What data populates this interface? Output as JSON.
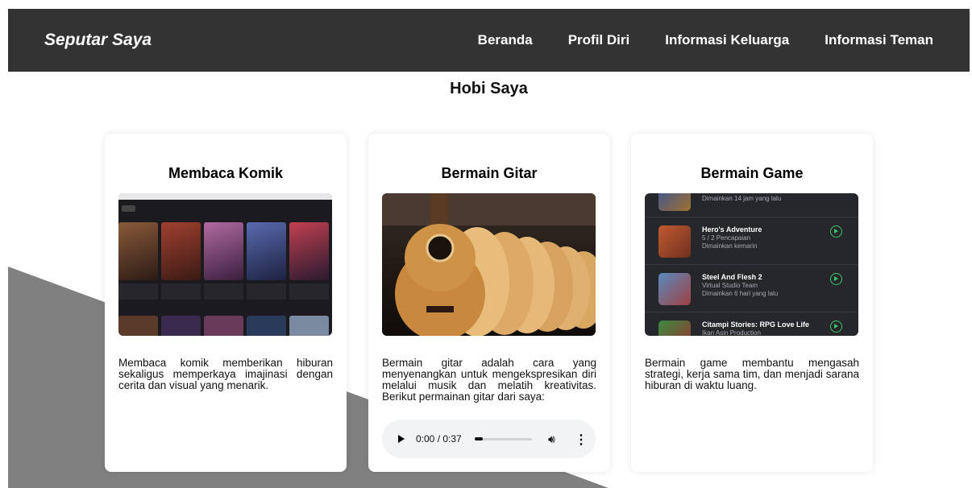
{
  "navbar": {
    "brand": "Seputar Saya",
    "links": [
      "Beranda",
      "Profil Diri",
      "Informasi Keluarga",
      "Informasi Teman"
    ]
  },
  "section": {
    "title": "Hobi Saya"
  },
  "cards": [
    {
      "title": "Membaca Komik",
      "description": "Membaca komik memberikan hiburan sekaligus memperkaya imajinasi dengan cerita dan visual yang menarik."
    },
    {
      "title": "Bermain Gitar",
      "description": "Bermain gitar adalah cara yang menyenangkan untuk mengekspresikan diri melalui musik dan melatih kreativitas. Berikut permainan gitar dari saya:",
      "audio": {
        "time": "0:00 / 0:37",
        "progress": 0.0
      }
    },
    {
      "title": "Bermain Game",
      "description": "Bermain game membantu mengasah strategi, kerja sama tim, dan menjadi sarana hiburan di waktu luang.",
      "games": [
        {
          "name": "",
          "sub": "Dimainkan 14 jam yang lalu",
          "sub2": ""
        },
        {
          "name": "Hero's Adventure",
          "sub": "5 / 2 Pencapaian",
          "sub2": "Dimainkan kemarin"
        },
        {
          "name": "Steel And Flesh 2",
          "sub": "Virtual Studio Team",
          "sub2": "Dimainkan 6 hari yang lalu"
        },
        {
          "name": "Citampi Stories: RPG Love Life",
          "sub": "Ikan Asin Production",
          "sub2": ""
        }
      ]
    }
  ],
  "colors": {
    "navbar_bg": "#333333",
    "background_shape": "#808080",
    "accent_play": "#3ec46d"
  }
}
